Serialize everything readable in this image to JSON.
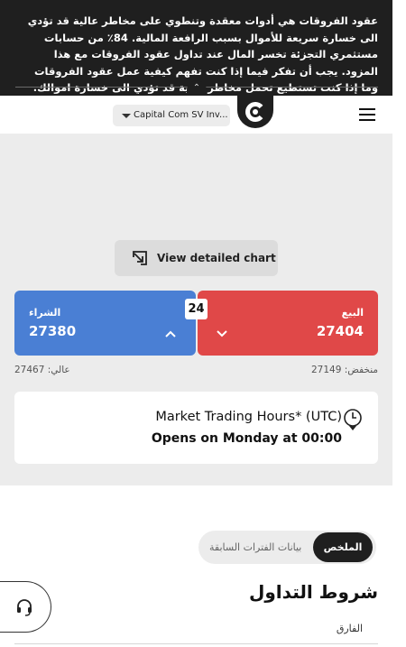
{
  "risk_warning": {
    "text": "عقود الفروقات هي أدوات معقدة وتنطوي على مخاطر عالية قد تؤدي الى خسارة سريعة للأموال بسبب الرافعة المالية. 84٪ من حسابات مستثمري التجزئة تخسر المال عند تداول عقود الفروقات مع هذا المزود. يجب أن تفكر فيما إذا كنت تفهم كيفية عمل عقود الفروقات وما إذا كنت تستطيع تحمل مخاطر عالية قد تؤدي الى خسارة اموالك.",
    "collapse_icon": "double-chevron-up-icon"
  },
  "header": {
    "entity_selector": "Capital Com SV Inv...",
    "logo_icon": "capital-com-logo-icon",
    "menu_icon": "hamburger-menu-icon"
  },
  "chart": {
    "button_label": "View detailed chart",
    "icon": "expand-arrow-icon"
  },
  "trade": {
    "buy_label": "الشراء",
    "buy_price": "27380",
    "sell_label": "البيع",
    "sell_price": "27404",
    "spread": "24",
    "low": "منخفض: 27149",
    "high": "عالي: 27467",
    "buy_color": "#4a7fd4",
    "sell_color": "#e04848"
  },
  "hours": {
    "title": "Market Trading Hours* (UTC)",
    "status": "Opens on Monday at 00:00",
    "icon": "clock-icon"
  },
  "tabs": {
    "summary": "الملخص",
    "history": "بيانات الفترات السابقة"
  },
  "terms": {
    "title": "شروط التداول",
    "spread_label": "الفارق"
  },
  "support": {
    "icon": "headset-support-icon"
  }
}
